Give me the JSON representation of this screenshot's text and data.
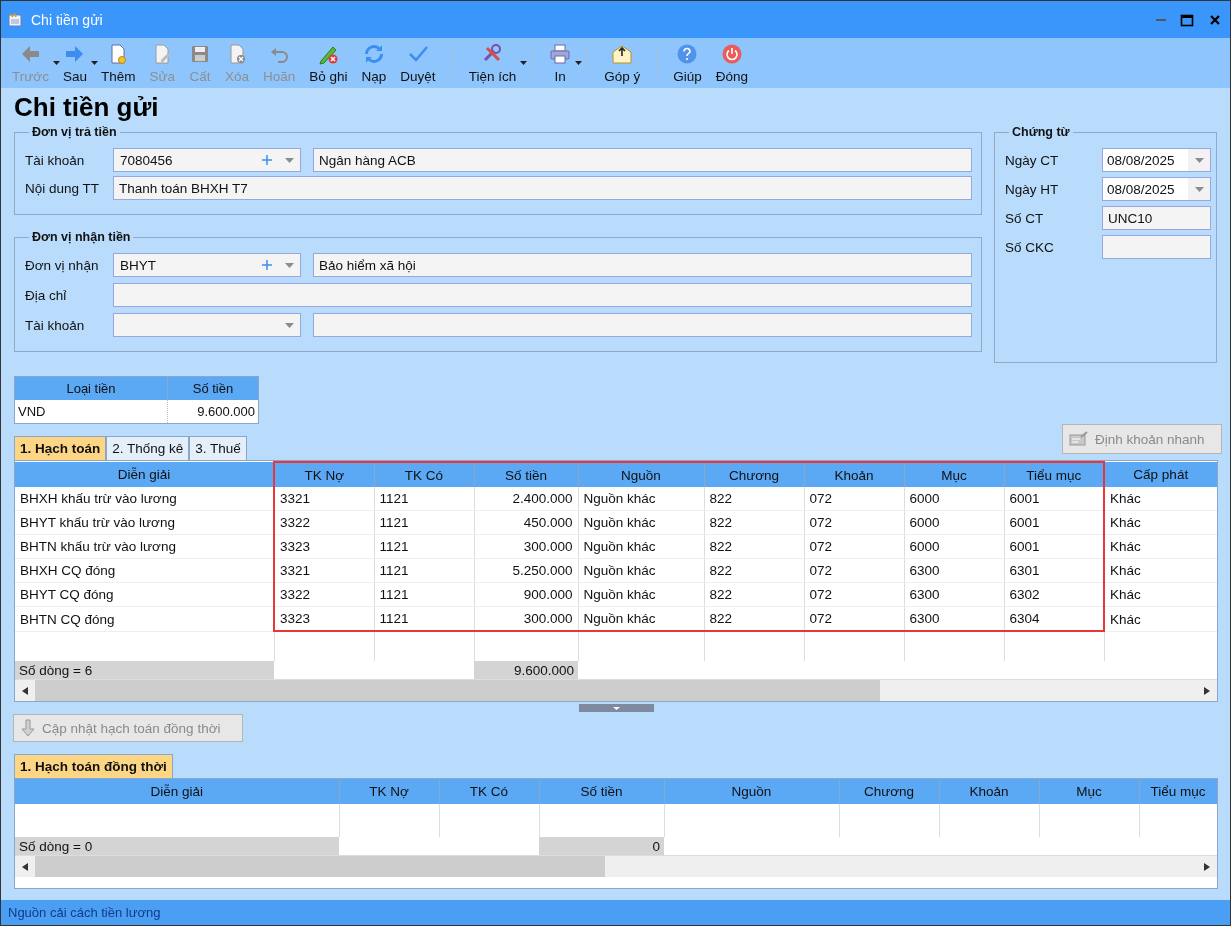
{
  "window": {
    "title": "Chi tiền gửi"
  },
  "toolbar": [
    {
      "kind": "button",
      "label": "Trước",
      "disabled": true,
      "dropdown": true
    },
    {
      "kind": "button",
      "label": "Sau",
      "disabled": false,
      "dropdown": true
    },
    {
      "kind": "button",
      "label": "Thêm",
      "disabled": false,
      "dropdown": false
    },
    {
      "kind": "button",
      "label": "Sửa",
      "disabled": true,
      "dropdown": false
    },
    {
      "kind": "button",
      "label": "Cất",
      "disabled": true,
      "dropdown": false
    },
    {
      "kind": "button",
      "label": "Xóa",
      "disabled": true,
      "dropdown": false
    },
    {
      "kind": "button",
      "label": "Hoãn",
      "disabled": true,
      "dropdown": false
    },
    {
      "kind": "button",
      "label": "Bỏ ghi",
      "disabled": false,
      "dropdown": false
    },
    {
      "kind": "button",
      "label": "Nạp",
      "disabled": false,
      "dropdown": false
    },
    {
      "kind": "button",
      "label": "Duyệt",
      "disabled": false,
      "dropdown": false
    },
    {
      "kind": "separator"
    },
    {
      "kind": "button",
      "label": "Tiện ích",
      "disabled": false,
      "dropdown": true
    },
    {
      "kind": "separator"
    },
    {
      "kind": "button",
      "label": "In",
      "disabled": false,
      "dropdown": true
    },
    {
      "kind": "separator"
    },
    {
      "kind": "button",
      "label": "Góp ý",
      "disabled": false,
      "dropdown": false
    },
    {
      "kind": "separator"
    },
    {
      "kind": "button",
      "label": "Giúp",
      "disabled": false,
      "dropdown": false
    },
    {
      "kind": "button",
      "label": "Đóng",
      "disabled": false,
      "dropdown": false
    }
  ],
  "heading": "Chi tiền gửi",
  "payer": {
    "legend": "Đơn vị trả tiền",
    "fields": [
      {
        "label": "Tài khoản",
        "kind": "combo",
        "value": "7080456",
        "add": true,
        "detail": "Ngân hàng ACB"
      },
      {
        "label": "Nội dung TT",
        "kind": "text",
        "value": "Thanh toán BHXH T7"
      }
    ]
  },
  "payee": {
    "legend": "Đơn vị nhận tiền",
    "fields": [
      {
        "label": "Đơn vị nhận",
        "kind": "combo",
        "value": "BHYT",
        "add": true,
        "detail": "Bảo hiểm xã hội"
      },
      {
        "label": "Địa chỉ",
        "kind": "text"
      },
      {
        "label": "Tài khoản",
        "kind": "combo",
        "add": false
      }
    ]
  },
  "voucher": {
    "legend": "Chứng từ",
    "fields": [
      {
        "label": "Ngày CT",
        "kind": "date",
        "value": "08/08/2025"
      },
      {
        "label": "Ngày HT",
        "kind": "date",
        "value": "08/08/2025"
      },
      {
        "label": "Số CT",
        "kind": "text",
        "value": "UNC10"
      },
      {
        "label": "Số CKC",
        "kind": "text"
      }
    ]
  },
  "currency": {
    "columns": [
      "Loại tiền",
      "Số tiền"
    ],
    "rows": [
      [
        "VND",
        "9.600.000"
      ]
    ]
  },
  "tabs": [
    {
      "label": "1. Hạch toán",
      "selected": true
    },
    {
      "label": "2. Thống kê",
      "selected": false
    },
    {
      "label": "3. Thuế",
      "selected": false
    }
  ],
  "quick_entry_button": {
    "label": "Định khoản nhanh",
    "disabled": true
  },
  "entries": {
    "columns": [
      {
        "label": "Diễn giải",
        "kind": "text",
        "highlighted": false
      },
      {
        "label": "TK Nợ",
        "kind": "text",
        "highlighted": true
      },
      {
        "label": "TK Có",
        "kind": "text",
        "highlighted": true
      },
      {
        "label": "Số tiền",
        "kind": "amount",
        "highlighted": true
      },
      {
        "label": "Nguồn",
        "kind": "text",
        "highlighted": true
      },
      {
        "label": "Chương",
        "kind": "text",
        "highlighted": true
      },
      {
        "label": "Khoản",
        "kind": "text",
        "highlighted": true
      },
      {
        "label": "Mục",
        "kind": "text",
        "highlighted": true
      },
      {
        "label": "Tiểu mục",
        "kind": "text",
        "highlighted": true
      },
      {
        "label": "Cấp phát",
        "kind": "text",
        "highlighted": false
      }
    ],
    "rows": [
      [
        "BHXH khấu trừ vào lương",
        "3321",
        "1121",
        "2.400.000",
        "Nguồn khác",
        "822",
        "072",
        "6000",
        "6001",
        "Khác"
      ],
      [
        "BHYT khấu trừ vào lương",
        "3322",
        "1121",
        "450.000",
        "Nguồn khác",
        "822",
        "072",
        "6000",
        "6001",
        "Khác"
      ],
      [
        "BHTN khấu trừ vào lương",
        "3323",
        "1121",
        "300.000",
        "Nguồn khác",
        "822",
        "072",
        "6000",
        "6001",
        "Khác"
      ],
      [
        "BHXH CQ đóng",
        "3321",
        "1121",
        "5.250.000",
        "Nguồn khác",
        "822",
        "072",
        "6300",
        "6301",
        "Khác"
      ],
      [
        "BHYT CQ đóng",
        "3322",
        "1121",
        "900.000",
        "Nguồn khác",
        "822",
        "072",
        "6300",
        "6302",
        "Khác"
      ],
      [
        "BHTN CQ đóng",
        "3323",
        "1121",
        "300.000",
        "Nguồn khác",
        "822",
        "072",
        "6300",
        "6304",
        "Khác"
      ]
    ],
    "footer": {
      "count": "Số dòng = 6",
      "total": "9.600.000"
    }
  },
  "update_button": {
    "label": "Cập nhật hạch toán đồng thời",
    "disabled": true
  },
  "lower_tabs": [
    {
      "label": "1. Hạch toán đồng thời",
      "selected": true
    }
  ],
  "concurrent": {
    "columns": [
      {
        "label": "Diễn giải",
        "kind": "text"
      },
      {
        "label": "TK Nợ",
        "kind": "text"
      },
      {
        "label": "TK Có",
        "kind": "text"
      },
      {
        "label": "Số tiền",
        "kind": "amount"
      },
      {
        "label": "Nguồn",
        "kind": "text"
      },
      {
        "label": "Chương",
        "kind": "text"
      },
      {
        "label": "Khoản",
        "kind": "text"
      },
      {
        "label": "Mục",
        "kind": "text"
      },
      {
        "label": "Tiểu mục",
        "kind": "text"
      }
    ],
    "footer": {
      "count": "Số dòng = 0",
      "total": "0"
    }
  },
  "status_bar": "Nguồn cải cách tiền lương"
}
